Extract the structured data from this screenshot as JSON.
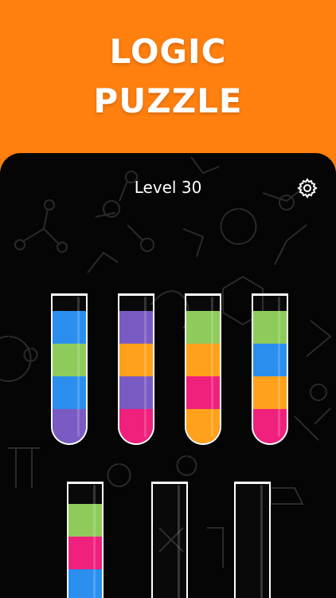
{
  "promo": {
    "line1": "LOGIC",
    "line2": "PUZZLE"
  },
  "game": {
    "level_label": "Level 30",
    "settings_icon": "gear-icon"
  },
  "colors": {
    "background": "#FF7F0F",
    "board": "#050505",
    "blue": "#2A8FEF",
    "green": "#8FCB5A",
    "purple": "#7A5BC4",
    "orange": "#FFA11A",
    "pink": "#F0207D"
  },
  "tubes": [
    {
      "id": 1,
      "layers_top_to_bottom": [
        "blue",
        "green",
        "blue",
        "purple"
      ]
    },
    {
      "id": 2,
      "layers_top_to_bottom": [
        "purple",
        "orange",
        "purple",
        "pink"
      ]
    },
    {
      "id": 3,
      "layers_top_to_bottom": [
        "green",
        "orange",
        "pink",
        "orange"
      ]
    },
    {
      "id": 4,
      "layers_top_to_bottom": [
        "green",
        "blue",
        "orange",
        "pink"
      ]
    },
    {
      "id": 5,
      "layers_top_to_bottom": [
        "green",
        "pink",
        "blue"
      ]
    },
    {
      "id": 6,
      "layers_top_to_bottom": []
    },
    {
      "id": 7,
      "layers_top_to_bottom": []
    }
  ]
}
